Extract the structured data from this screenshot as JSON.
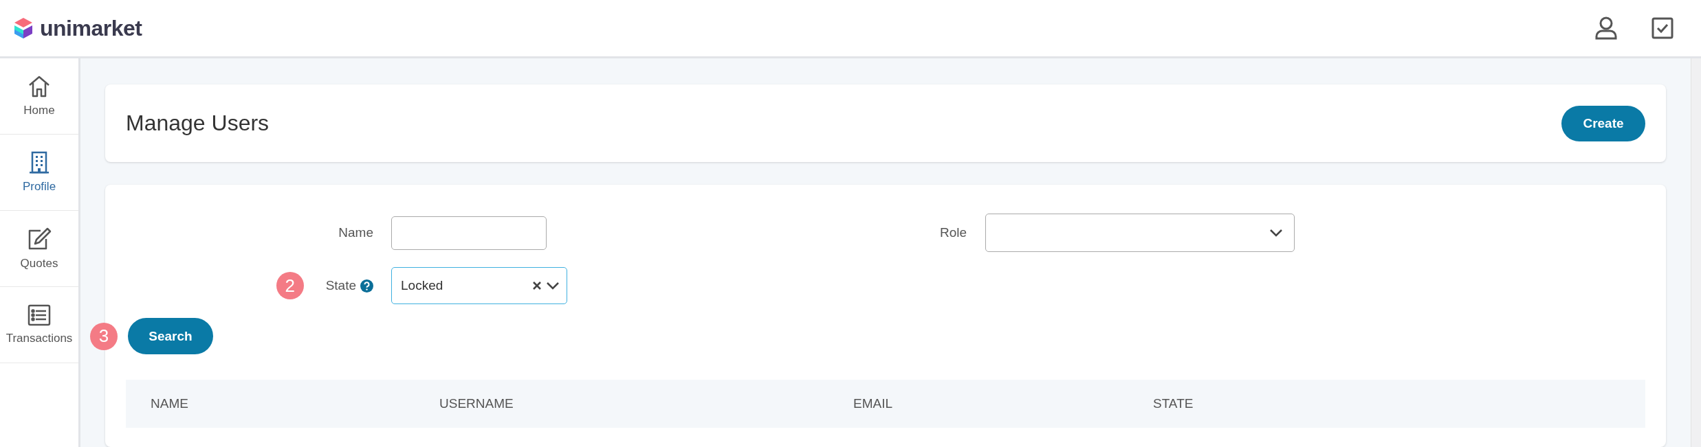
{
  "header": {
    "logo_text": "unimarket"
  },
  "sidebar": {
    "items": [
      {
        "label": "Home",
        "kind": "home",
        "selected": false
      },
      {
        "label": "Profile",
        "kind": "building",
        "selected": true
      },
      {
        "label": "Quotes",
        "kind": "edit",
        "selected": false
      },
      {
        "label": "Transactions",
        "kind": "list",
        "selected": false
      }
    ]
  },
  "page": {
    "title": "Manage Users",
    "create_button": "Create"
  },
  "filters": {
    "name": {
      "label": "Name"
    },
    "role": {
      "label": "Role"
    },
    "state": {
      "label": "State",
      "value": "Locked",
      "step": "2"
    },
    "search_button": "Search",
    "search_step": "3"
  },
  "table": {
    "columns": [
      "NAME",
      "USERNAME",
      "EMAIL",
      "STATE"
    ]
  }
}
